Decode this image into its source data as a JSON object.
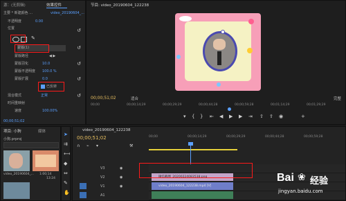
{
  "effect_controls": {
    "tab_source": "源：(无剪辑)",
    "tab_effects": "效果控件",
    "clip_path": "主要 * 新建颜色 ...",
    "seq_name": "video_20190604_...",
    "time_start": "00:00",
    "rows": [
      {
        "label": "不透明度",
        "value": "0.00"
      },
      {
        "label": "位置",
        "value": ""
      },
      {
        "label": "蒙版(1)",
        "value": ""
      },
      {
        "label": "蒙版路径",
        "value": ""
      },
      {
        "label": "蒙版羽化",
        "value": "10.0"
      },
      {
        "label": "蒙版不透明度",
        "value": "100.0 %"
      },
      {
        "label": "蒙版扩展",
        "value": "0.0"
      },
      {
        "label": "已反转",
        "value": ""
      },
      {
        "label": "混合模式",
        "value": "正常"
      },
      {
        "label": "时间重映射",
        "value": ""
      },
      {
        "label": "速度",
        "value": "100.00%"
      }
    ],
    "bottom_time": "00;00;51;02"
  },
  "program": {
    "title": "节目: video_20190604_122238",
    "timecode": "00;00;51;02",
    "fit": "适合",
    "ratio": "完整",
    "ruler": [
      "00;00",
      "00;00;14;29",
      "00;00;29;29",
      "00;00;44;28",
      "00;00;59;28",
      "00;01;14;29",
      "00;01;29;29"
    ]
  },
  "project": {
    "tab": "项目: 小狗",
    "tab2": "媒体",
    "file": "小狗.prproj",
    "items": [
      {
        "name": "video_20190604_...",
        "dur": "1:00;14"
      },
      {
        "name": "video_20190604_...",
        "dur": "13:24"
      }
    ]
  },
  "timeline": {
    "tab": "video_20190604_122238",
    "timecode": "00;00;51;02",
    "ruler": [
      "00;00",
      "00;00;14;29",
      "00;00;29;29",
      "00;00;44;28",
      "00;00;59;28"
    ],
    "tracks": [
      {
        "name": "V3"
      },
      {
        "name": "V2"
      },
      {
        "name": "V1"
      },
      {
        "name": "A1"
      }
    ],
    "clip_image": "微信截图_20200224083538.png",
    "clip_video": "video_20190604_122238.mp4 [V]"
  },
  "watermark": {
    "brand_left": "Bai",
    "brand_right": "经验",
    "url": "jingyan.baidu.com"
  }
}
